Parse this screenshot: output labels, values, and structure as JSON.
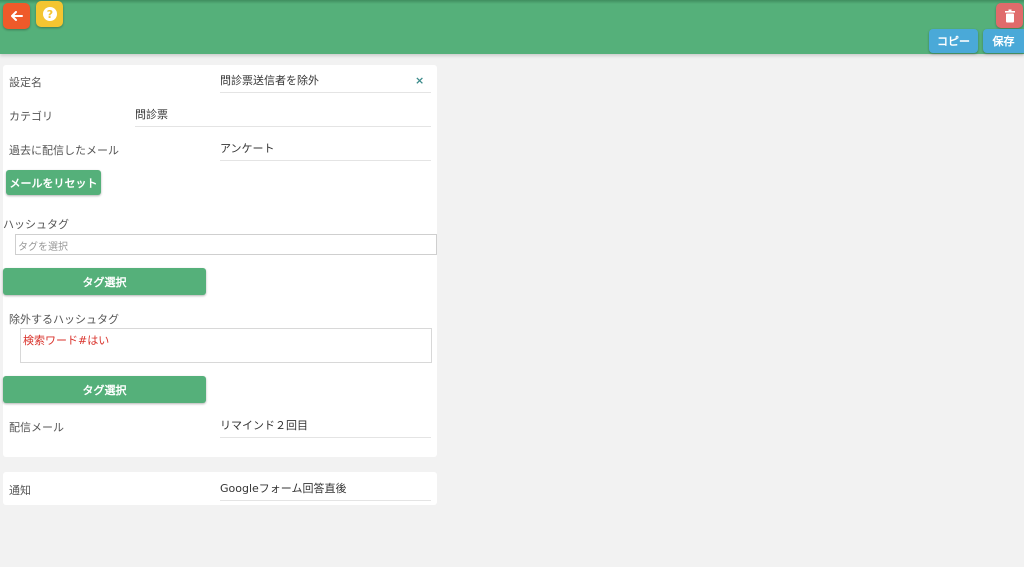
{
  "toolbar": {
    "copy_label": "コピー",
    "save_label": "保存",
    "back_icon": "arrow-left-icon",
    "help_icon": "question-icon",
    "delete_icon": "trash-icon"
  },
  "form": {
    "setting_name_label": "設定名",
    "setting_name_value": "問診票送信者を除外",
    "category_label": "カテゴリ",
    "category_value": "問診票",
    "past_mail_label": "過去に配信したメール",
    "past_mail_value": "アンケート",
    "reset_mail_button": "メールをリセット",
    "hashtag_label": "ハッシュタグ",
    "hashtag_placeholder": "タグを選択",
    "tag_select_button": "タグ選択",
    "exclude_hashtag_label": "除外するハッシュタグ",
    "exclude_hashtag_value": "検索ワード#はい",
    "tag_select_button_2": "タグ選択",
    "delivery_mail_label": "配信メール",
    "delivery_mail_value": "リマインド２回目"
  },
  "notify": {
    "label": "通知",
    "value": "Googleフォーム回答直後"
  },
  "colors": {
    "header": "#55b07a",
    "accent_blue": "#4aa9d8",
    "back": "#ef5a2a",
    "help": "#f4c531",
    "delete": "#e06b6b",
    "exclude_tag_text": "#d9322b"
  }
}
